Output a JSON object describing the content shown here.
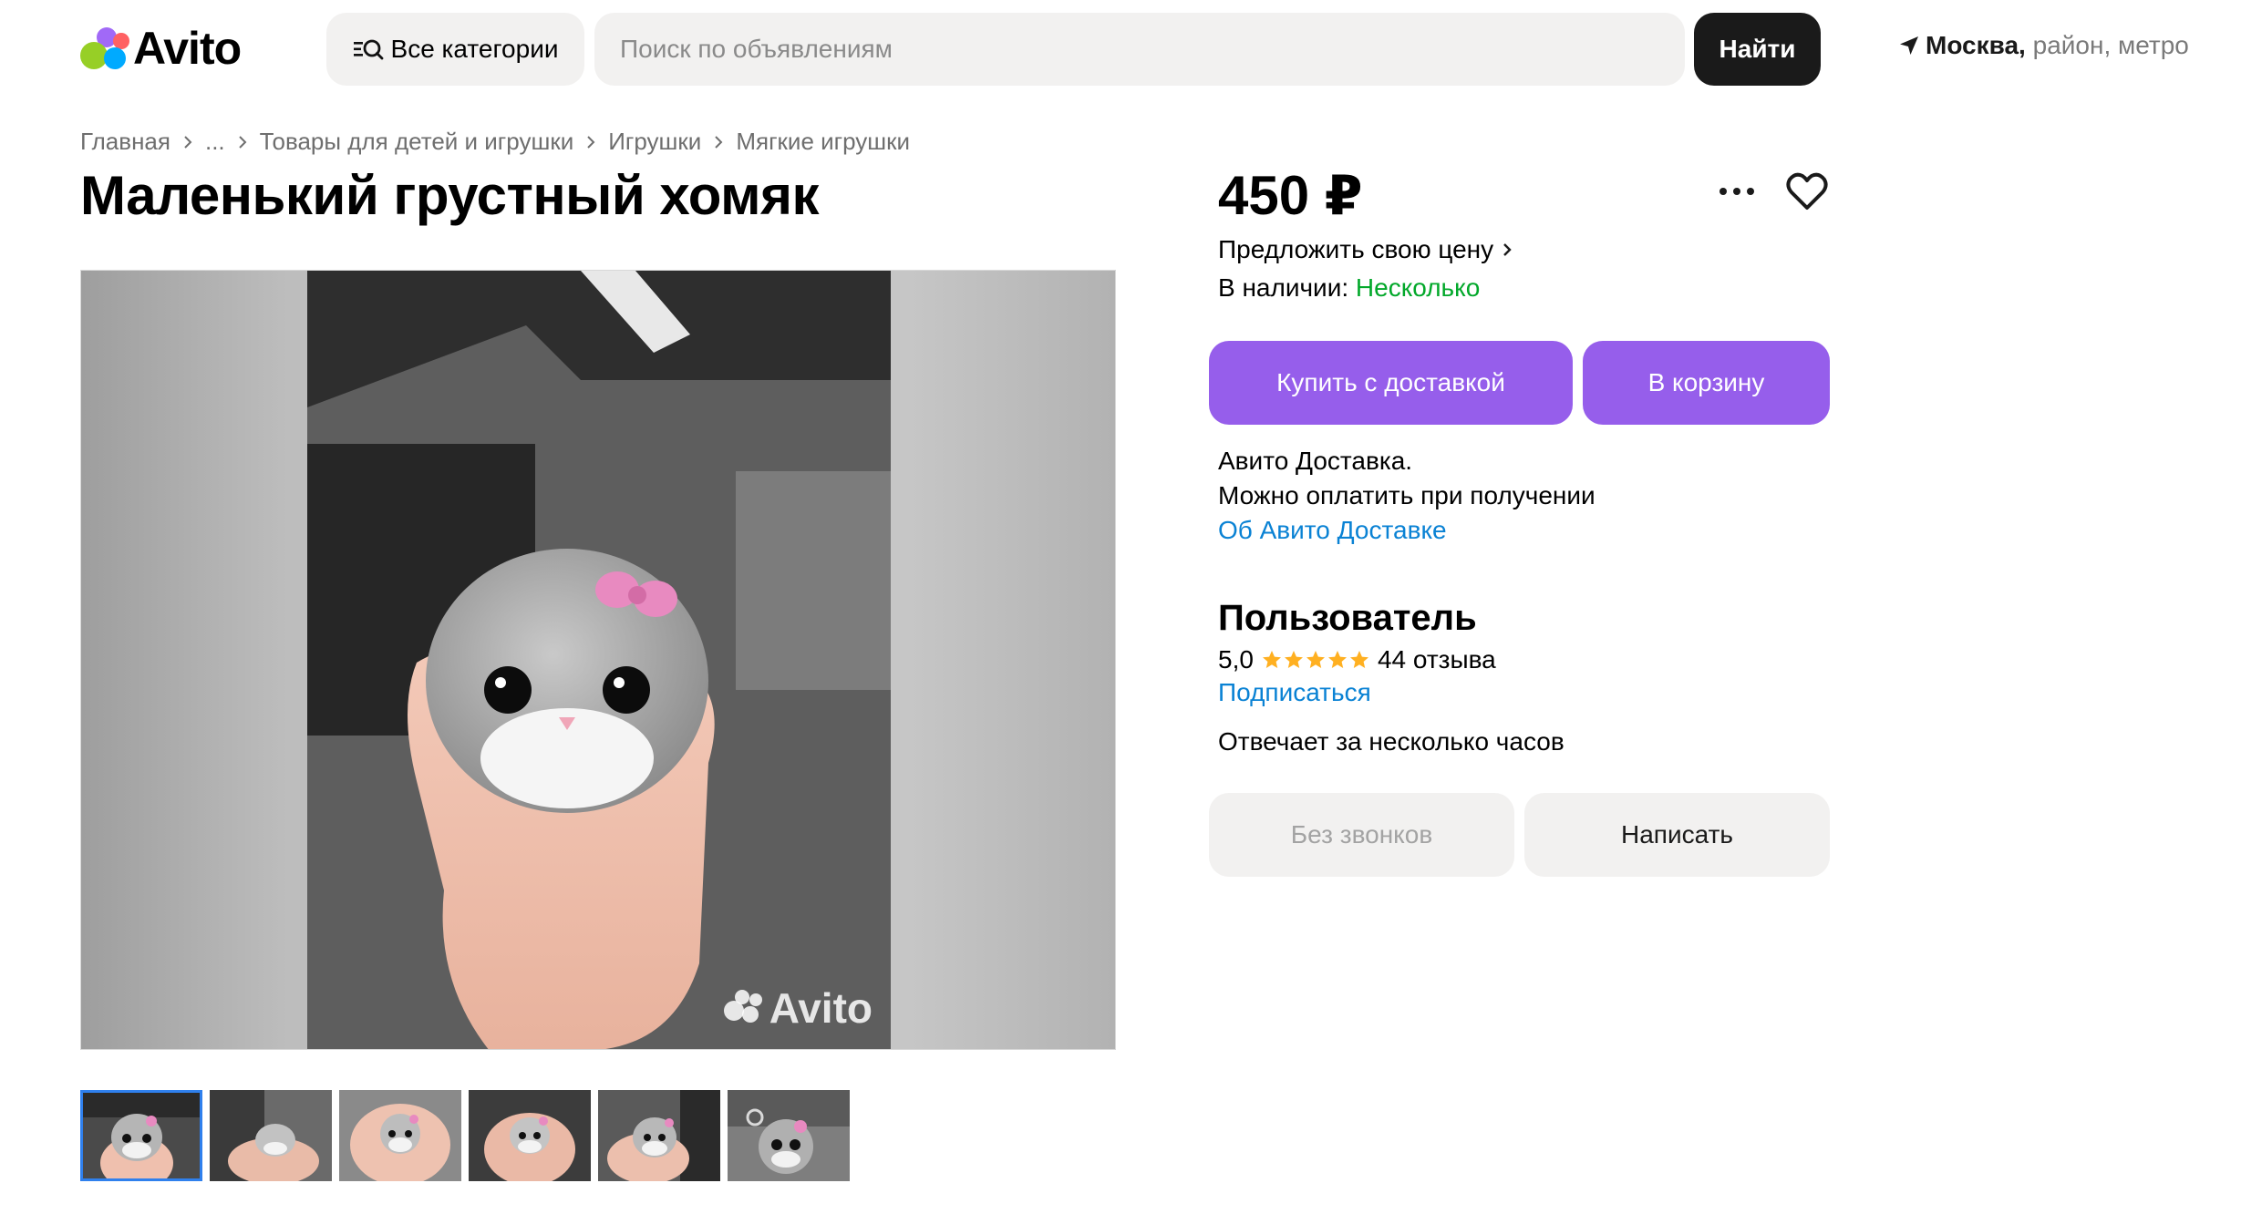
{
  "brand": {
    "name": "Avito",
    "dot_colors": [
      "#00aaff",
      "#97cf26",
      "#a169f7",
      "#ff6163"
    ]
  },
  "header": {
    "categories_label": "Все категории",
    "search_placeholder": "Поиск по объявлениям",
    "search_value": "",
    "find_label": "Найти",
    "location_city": "Москва,",
    "location_rest": " район, метро"
  },
  "breadcrumb": [
    "Главная",
    "...",
    "Товары для детей и игрушки",
    "Игрушки",
    "Мягкие игрушки"
  ],
  "listing": {
    "title": "Маленький грустный хомяк",
    "price": "450 ₽",
    "offer_label": "Предложить свою цену",
    "stock_label": "В наличии:",
    "stock_value": "Несколько",
    "photo_watermark": "Avito",
    "thumbnail_count": 6
  },
  "actions": {
    "buy_label": "Купить с доставкой",
    "cart_label": "В корзину"
  },
  "delivery": {
    "line1": "Авито Доставка.",
    "line2": "Можно оплатить при получении",
    "link": "Об Авито Доставке"
  },
  "seller": {
    "name": "Пользователь",
    "rating": "5,0",
    "stars": 5,
    "reviews": "44 отзыва",
    "subscribe": "Подписаться",
    "reply_time": "Отвечает за несколько часов",
    "no_calls_label": "Без звонков",
    "write_label": "Написать"
  },
  "colors": {
    "accent_purple": "#965eeb",
    "link_blue": "#0a82d4",
    "stock_green": "#02a82a",
    "star_yellow": "#ffb021",
    "thumb_active": "#2f80ed"
  }
}
